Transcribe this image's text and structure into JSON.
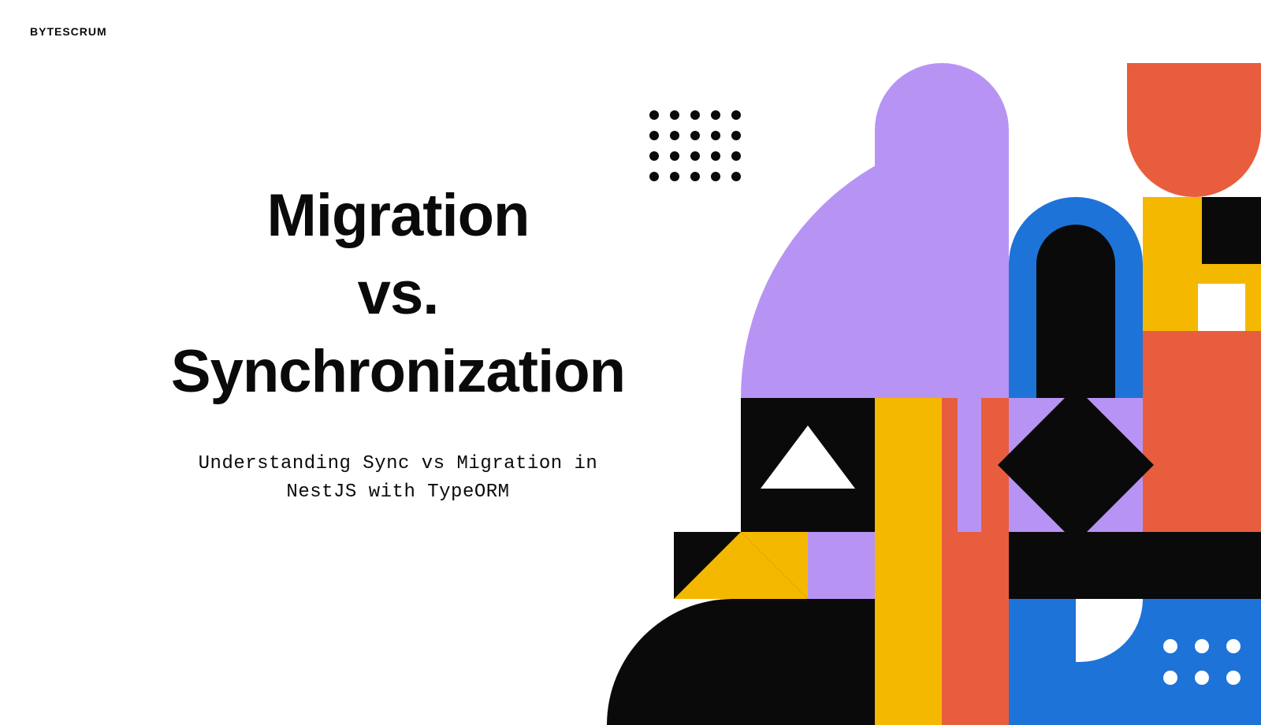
{
  "brand": "BYTESCRUM",
  "title_line1": "Migration",
  "title_line2": "vs.",
  "title_line3": "Synchronization",
  "subtitle_line1": "Understanding Sync vs Migration in",
  "subtitle_line2": "NestJS with TypeORM",
  "colors": {
    "black": "#0a0a0a",
    "white": "#ffffff",
    "purple": "#b794f4",
    "orange": "#e85d3d",
    "yellow": "#f5b800",
    "blue": "#1e73d8"
  }
}
